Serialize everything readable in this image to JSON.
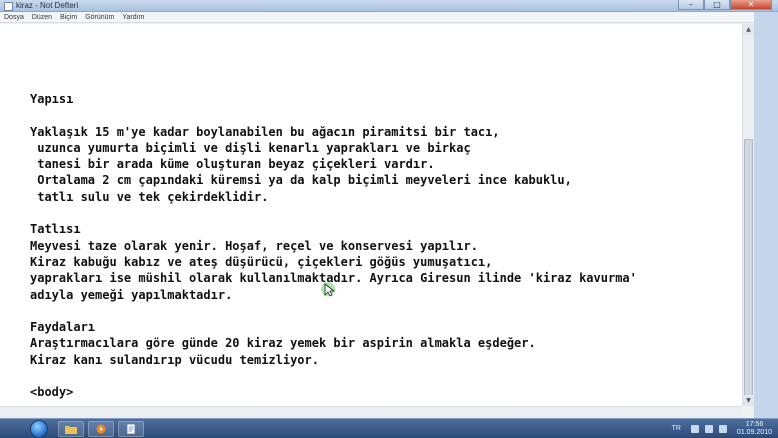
{
  "window": {
    "title": "kiraz - Not Defteri",
    "min_glyph": "–",
    "max_glyph": "□",
    "close_glyph": "✕"
  },
  "menu": {
    "items": [
      "Dosya",
      "Düzen",
      "Biçim",
      "Görünüm",
      "Yardım"
    ]
  },
  "document": {
    "lines": [
      "Yapısı",
      "",
      "Yaklaşık 15 m'ye kadar boylanabilen bu ağacın piramitsi bir tacı,",
      " uzunca yumurta biçimli ve dişli kenarlı yaprakları ve birkaç",
      " tanesi bir arada küme oluşturan beyaz çiçekleri vardır.",
      " Ortalama 2 cm çapındaki küremsi ya da kalp biçimli meyveleri ince kabuklu,",
      " tatlı sulu ve tek çekirdeklidir.",
      "",
      "Tatlısı",
      "Meyvesi taze olarak yenir. Hoşaf, reçel ve konservesi yapılır.",
      "Kiraz kabuğu kabız ve ateş düşürücü, çiçekleri göğüs yumuşatıcı,",
      "yaprakları ise müshil olarak kullanılmaktadır. Ayrıca Giresun ilinde 'kiraz kavurma'",
      "adıyla yemeği yapılmaktadır.",
      "",
      "Faydaları",
      "Araştırmacılara göre günde 20 kiraz yemek bir aspirin almakla eşdeğer.",
      "Kiraz kanı sulandırıp vücudu temizliyor.",
      "",
      "<body>"
    ]
  },
  "scrollbar": {
    "up_glyph": "▲",
    "down_glyph": "▼"
  },
  "taskbar": {
    "language": "TR",
    "time": "17:56",
    "date": "01.09.2010"
  },
  "colors": {
    "taskbar": "#2c4a78",
    "cursor": "#3fd13f"
  }
}
